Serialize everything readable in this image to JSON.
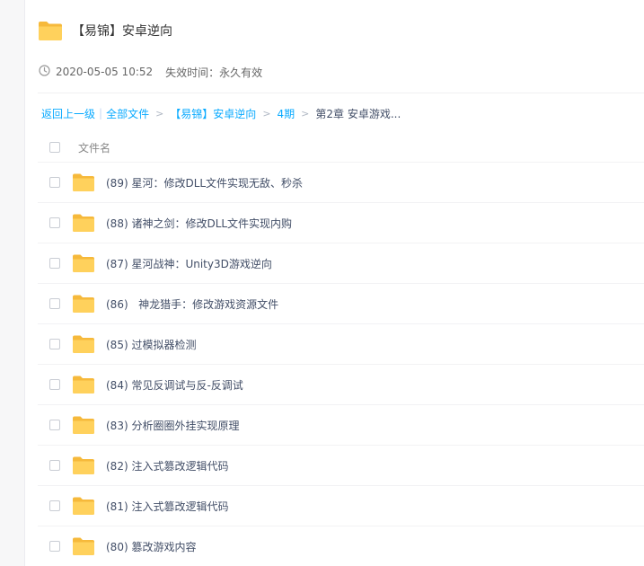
{
  "share": {
    "title": "【易锦】安卓逆向",
    "created": "2020-05-05 10:52",
    "expire": "失效时间：永久有效"
  },
  "breadcrumb": {
    "back": "返回上一级",
    "all_files": "全部文件",
    "crumb1": "【易锦】安卓逆向",
    "crumb2": "4期",
    "current": "第2章 安卓游戏..."
  },
  "list": {
    "column_name": "文件名",
    "rows": [
      "(89) 星河：修改DLL文件实现无敌、秒杀",
      "(88) 诸神之剑：修改DLL文件实现内购",
      "(87) 星河战神：Unity3D游戏逆向",
      "(86)   神龙猎手：修改游戏资源文件",
      "(85) 过模拟器检测",
      "(84) 常见反调试与反-反调试",
      "(83) 分析圈圈外挂实现原理",
      "(82) 注入式篡改逻辑代码",
      "(81) 注入式篡改逻辑代码",
      "(80) 篡改游戏内容"
    ]
  },
  "icons": {
    "folder": "folder-icon",
    "clock": "clock-icon"
  },
  "colors": {
    "folder": "#ffd15c",
    "folder_tab": "#f6b93b",
    "link": "#09aaff",
    "text": "#424e67"
  }
}
